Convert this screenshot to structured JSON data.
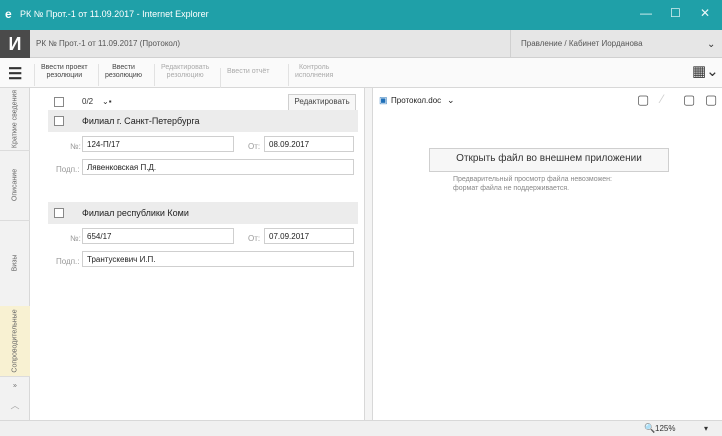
{
  "window": {
    "title": "РК № Прот.-1 от 11.09.2017 - Internet Explorer",
    "controls": [
      "—",
      "☐",
      "✕"
    ]
  },
  "appbar": {
    "logo": "И",
    "doc_title": "РК № Прот.-1 от 11.09.2017 (Протокол)",
    "user": "Правление / Кабинет Иорданова"
  },
  "toolbar": {
    "buttons": [
      {
        "label1": "Ввести проект",
        "label2": "резолюции",
        "enabled": true
      },
      {
        "label1": "Ввести",
        "label2": "резолюцию",
        "enabled": true
      },
      {
        "label1": "Редактировать",
        "label2": "резолюцию",
        "enabled": false
      },
      {
        "label1": "Ввести отчёт",
        "label2": "",
        "enabled": false
      },
      {
        "label1": "Контроль",
        "label2": "исполнения",
        "enabled": false
      }
    ]
  },
  "sidebar": {
    "tabs": [
      "Краткие сведения",
      "Описание",
      "Визы",
      "Сопроводительные",
      "»"
    ]
  },
  "list": {
    "counter": "0/2",
    "edit_button": "Редактировать",
    "items": [
      {
        "name": "Филиал г. Санкт-Петербурга",
        "num_label": "№:",
        "num": "124-П/17",
        "date_label": "От:",
        "date": "08.09.2017",
        "signer_label": "Подп.:",
        "signer": "Лявенковская П.Д."
      },
      {
        "name": "Филиал республики Коми",
        "num_label": "№:",
        "num": "654/17",
        "date_label": "От:",
        "date": "07.09.2017",
        "signer_label": "Подп.:",
        "signer": "Трантускевич И.П."
      }
    ]
  },
  "file": {
    "name": "Протокол.doc",
    "open_button": "Открыть файл во внешнем приложении",
    "note_line1": "Предварительный просмотр файла невозможен:",
    "note_line2": "формат файла не поддерживается."
  },
  "status": {
    "zoom": "125%"
  }
}
